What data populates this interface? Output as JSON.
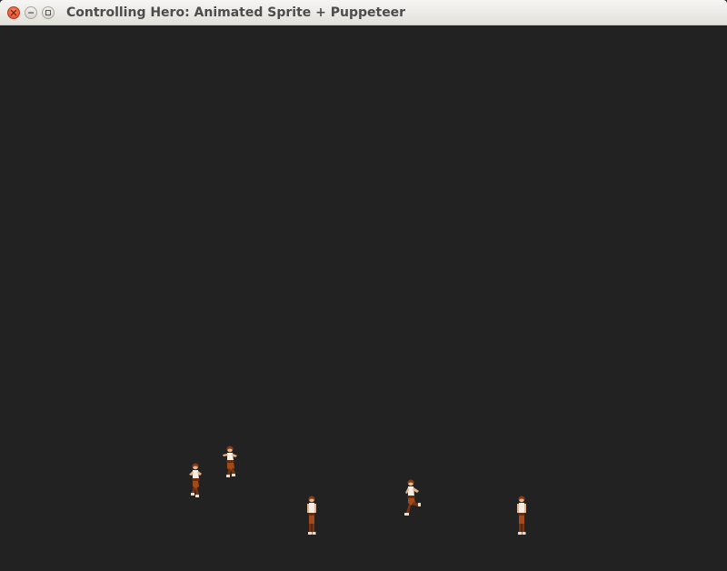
{
  "window": {
    "title": "Controlling Hero: Animated Sprite + Puppeteer",
    "controls": {
      "close_icon": "close-icon",
      "minimize_icon": "minimize-icon",
      "maximize_icon": "maximize-icon"
    }
  },
  "scene": {
    "background_color": "#222222",
    "sprites": [
      {
        "name": "hero-jumping",
        "pose": "jump"
      },
      {
        "name": "hero-crouch-jumping",
        "pose": "jump-crouch"
      },
      {
        "name": "hero-standing",
        "pose": "stand"
      },
      {
        "name": "hero-running",
        "pose": "run"
      },
      {
        "name": "hero-standing",
        "pose": "stand"
      }
    ]
  }
}
